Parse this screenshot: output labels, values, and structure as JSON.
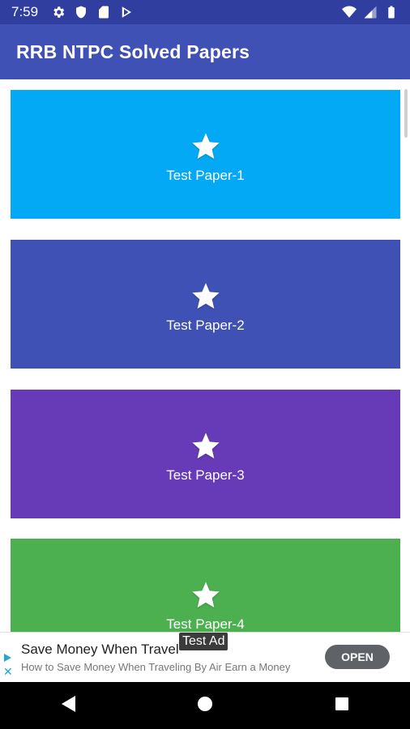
{
  "status_bar": {
    "time": "7:59",
    "left_icons": [
      "gear-icon",
      "shield-icon",
      "sd-card-icon",
      "play-store-icon"
    ],
    "right_icons": [
      "wifi-icon",
      "signal-icon",
      "battery-icon"
    ]
  },
  "app_bar": {
    "title": "RRB NTPC Solved Papers"
  },
  "cards": [
    {
      "label": "Test Paper-1",
      "color": "#03a9f4",
      "icon": "star-icon"
    },
    {
      "label": "Test Paper-2",
      "color": "#3f51b5",
      "icon": "star-icon"
    },
    {
      "label": "Test Paper-3",
      "color": "#673ab7",
      "icon": "star-icon"
    },
    {
      "label": "Test Paper-4",
      "color": "#4caf50",
      "icon": "star-icon"
    }
  ],
  "ad": {
    "badge": "Test Ad",
    "title": "Save Money When Travel",
    "description": "How to Save Money When Traveling By Air Earn a Money",
    "cta": "OPEN"
  },
  "nav_bar": {
    "buttons": [
      "back-icon",
      "home-icon",
      "recents-icon"
    ]
  }
}
